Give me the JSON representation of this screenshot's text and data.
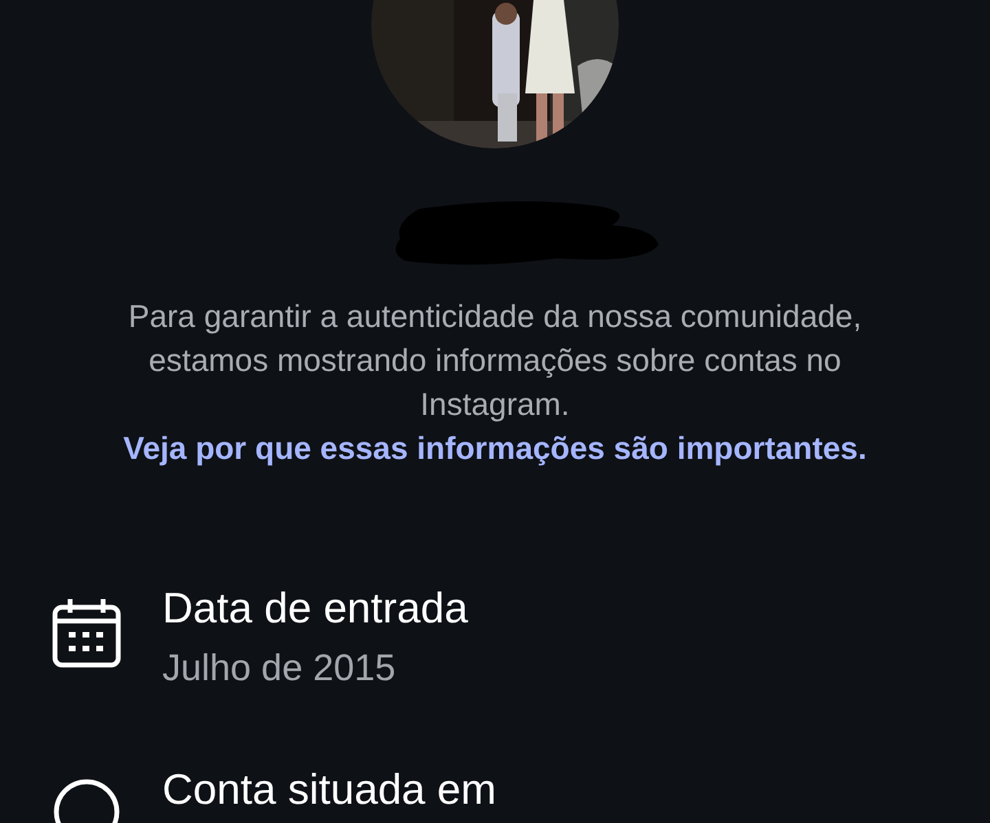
{
  "info_text": {
    "text": "Para garantir a autenticidade da nossa comunidade, estamos mostrando informações sobre contas no Instagram.",
    "link": "Veja por que essas informações são importantes."
  },
  "details": [
    {
      "kind": "calendar",
      "title": "Data de entrada",
      "value": "Julho de 2015"
    },
    {
      "kind": "location",
      "title": "Conta situada em"
    }
  ]
}
